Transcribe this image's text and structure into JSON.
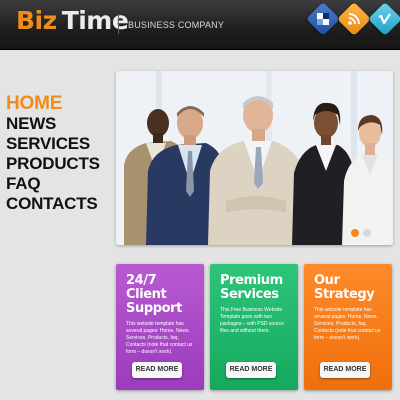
{
  "header": {
    "logo_part1": "Biz",
    "logo_part2": "Time",
    "tagline": "BUSINESS COMPANY",
    "logo_color_primary": "#f08c1c",
    "social_icons": [
      "delicious-icon",
      "rss-icon",
      "vimeo-icon"
    ]
  },
  "nav": {
    "items": [
      "HOME",
      "NEWS",
      "SERVICES",
      "PRODUCTS",
      "FAQ",
      "CONTACTS"
    ],
    "active": "HOME",
    "active_color": "#f08c1c"
  },
  "slider": {
    "slide_count": 2,
    "current_slide": 1
  },
  "cards": [
    {
      "title": "24/7 Client Support",
      "text": "This website template has several pages: Home, News, Services, Products, faq, Contacts (note that contact us form – doesn't work).",
      "button": "READ MORE",
      "color": "#a947c6"
    },
    {
      "title": "Premium Services",
      "text": "This Free Business Website Template goes with two packages – with PSD source files and without them.",
      "button": "READ MORE",
      "color": "#1fb46a"
    },
    {
      "title": "Our Strategy",
      "text": "This website template has several pages: Home, News, Services, Products, faq, Contacts (note that contact us form – doesn't work).",
      "button": "READ MORE",
      "color": "#f57a18"
    }
  ]
}
